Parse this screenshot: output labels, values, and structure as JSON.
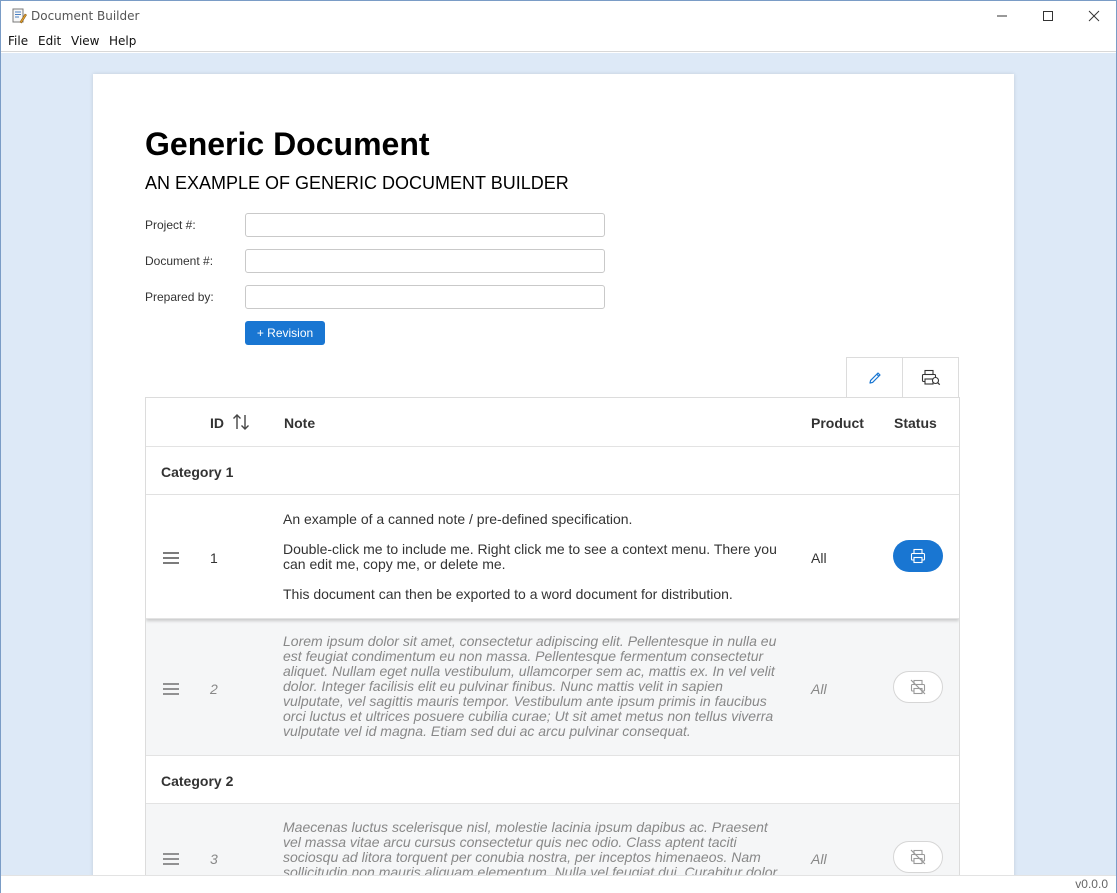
{
  "window": {
    "title": "Document Builder",
    "icon": "document-pencil-icon"
  },
  "menu": {
    "items": [
      {
        "label": "File"
      },
      {
        "label": "Edit"
      },
      {
        "label": "View"
      },
      {
        "label": "Help"
      }
    ]
  },
  "document": {
    "title": "Generic Document",
    "subtitle": "AN EXAMPLE OF GENERIC DOCUMENT BUILDER",
    "fields": [
      {
        "label": "Project #:",
        "value": "",
        "placeholder": ""
      },
      {
        "label": "Document #:",
        "value": "",
        "placeholder": ""
      },
      {
        "label": "Prepared by:",
        "value": "",
        "placeholder": ""
      }
    ],
    "revision_button": "+ Revision"
  },
  "tabs": [
    {
      "name": "edit",
      "icon": "pencil-icon",
      "active": true
    },
    {
      "name": "preview",
      "icon": "print-preview-icon",
      "active": false
    }
  ],
  "table": {
    "headers": {
      "id": "ID",
      "note": "Note",
      "product": "Product",
      "status": "Status"
    },
    "sort_icon": "sort-arrows-icon",
    "categories": [
      {
        "label": "Category 1"
      },
      {
        "label": "Category 2"
      }
    ],
    "rows": [
      {
        "id": "1",
        "note": [
          "An example of a canned note / pre-defined specification.",
          "Double-click me to include me. Right click me to see a context menu. There you can edit me, copy me, or delete me.",
          "This document can then be exported to a word document for distribution."
        ],
        "product": "All",
        "status": "included",
        "status_icon": "printer-icon"
      },
      {
        "id": "2",
        "note": [
          "Lorem ipsum dolor sit amet, consectetur adipiscing elit. Pellentesque in nulla eu est feugiat condimentum eu non massa. Pellentesque fermentum consectetur aliquet. Nullam eget nulla vestibulum, ullamcorper sem ac, mattis ex. In vel velit dolor. Integer facilisis elit eu pulvinar finibus. Nunc mattis velit in sapien vulputate, vel sagittis mauris tempor. Vestibulum ante ipsum primis in faucibus orci luctus et ultrices posuere cubilia curae; Ut sit amet metus non tellus viverra vulputate vel id magna. Etiam sed dui ac arcu pulvinar consequat."
        ],
        "product": "All",
        "status": "excluded",
        "status_icon": "printer-off-icon"
      },
      {
        "id": "3",
        "note": [
          "Maecenas luctus scelerisque nisl, molestie lacinia ipsum dapibus ac. Praesent vel massa vitae arcu cursus consectetur quis nec odio. Class aptent taciti sociosqu ad litora torquent per conubia nostra, per inceptos himenaeos. Nam sollicitudin non mauris aliquam elementum. Nulla vel feugiat dui. Curabitur dolor sapien, euismod a"
        ],
        "product": "All",
        "status": "excluded",
        "status_icon": "printer-off-icon"
      }
    ]
  },
  "status_bar": {
    "version": "v0.0.0"
  },
  "colors": {
    "accent": "#1976d2",
    "workspace_bg": "#dde9f7",
    "disabled_row_bg": "#f5f6f7"
  }
}
